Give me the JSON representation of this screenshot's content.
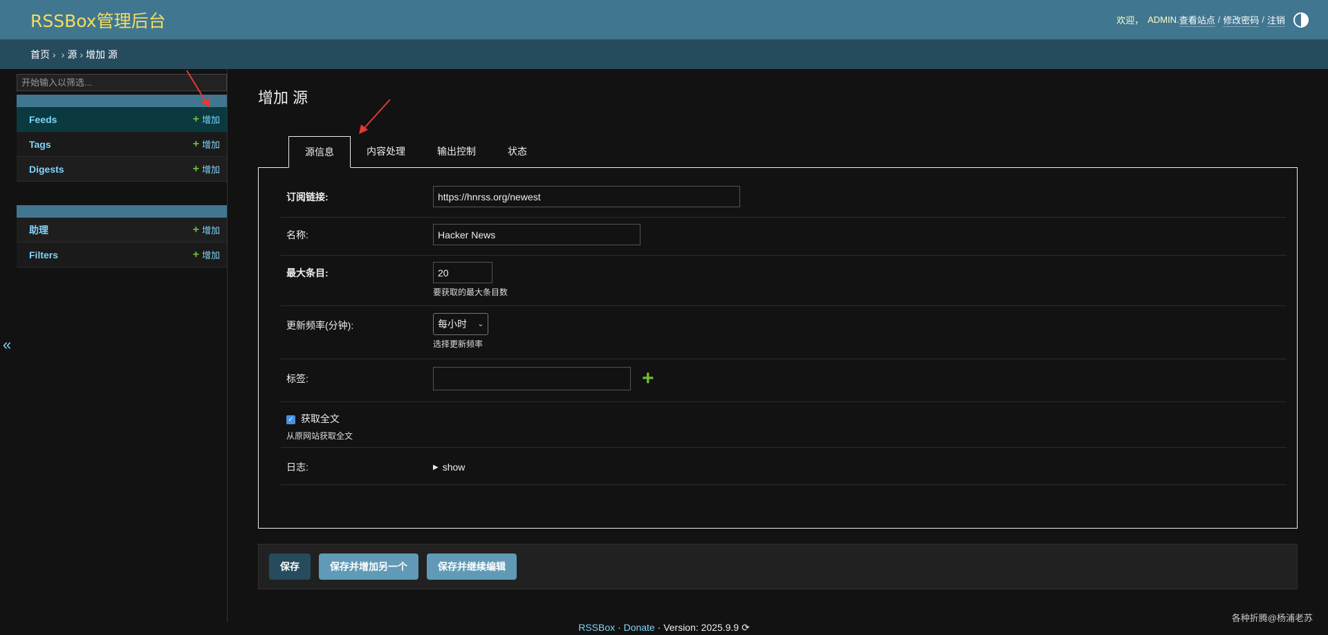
{
  "header": {
    "brand": "RSSBox管理后台",
    "welcome": "欢迎，",
    "username": "ADMIN.",
    "view_site": "查看站点",
    "change_password": "修改密码",
    "logout": "注销",
    "separator": "/"
  },
  "breadcrumbs": {
    "home": "首页",
    "arrow1": "›",
    "arrow2": "›",
    "section": "源",
    "arrow3": "›",
    "current": "增加 源"
  },
  "sidebar": {
    "filter_placeholder": "开始输入以筛选...",
    "add_label": "增加",
    "group1": [
      {
        "label": "Feeds"
      },
      {
        "label": "Tags"
      },
      {
        "label": "Digests"
      }
    ],
    "group2": [
      {
        "label": "助理"
      },
      {
        "label": "Filters"
      }
    ],
    "collapse_icon": "«"
  },
  "main": {
    "title": "增加 源",
    "tabs": [
      "源信息",
      "内容处理",
      "输出控制",
      "状态"
    ],
    "fields": {
      "feed_url": {
        "label": "订阅链接:",
        "value": "https://hnrss.org/newest"
      },
      "name": {
        "label": "名称:",
        "value": "Hacker News"
      },
      "max_items": {
        "label": "最大条目:",
        "value": "20",
        "help": "要获取的最大条目数"
      },
      "update_freq": {
        "label": "更新频率(分钟):",
        "value": "每小时",
        "help": "选择更新频率"
      },
      "tags": {
        "label": "标签:",
        "value": ""
      },
      "fetch_fulltext": {
        "label": "获取全文",
        "checked": true,
        "help": "从原网站获取全文"
      },
      "log": {
        "label": "日志:",
        "toggle": "show"
      }
    }
  },
  "buttons": {
    "save": "保存",
    "save_add_another": "保存并增加另一个",
    "save_continue": "保存并继续编辑"
  },
  "footer": {
    "app": "RSSBox",
    "dot1": "·",
    "donate": "Donate",
    "dot2": "·",
    "version": "Version: 2025.9.9",
    "credit": "各种折腾@杨浦老苏"
  },
  "colors": {
    "header_bg": "#417690",
    "breadcrumb_bg": "#264b5d",
    "brand": "#f5dd5d",
    "link": "#81d4fa",
    "add_plus": "#70bf2b",
    "annotation": "#e53935"
  }
}
